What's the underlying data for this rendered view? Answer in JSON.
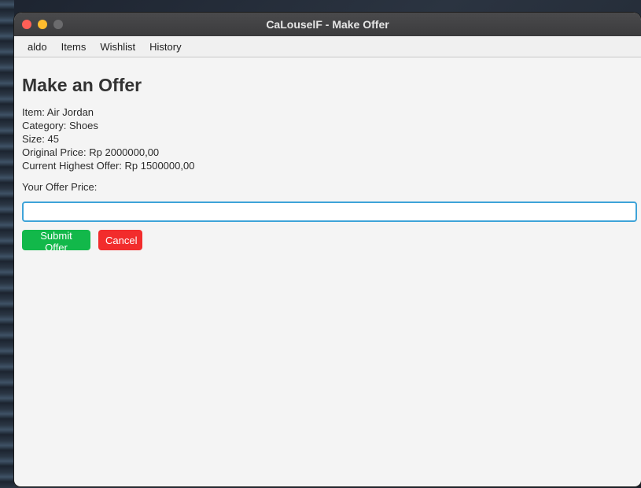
{
  "window": {
    "title": "CaLouselF - Make Offer"
  },
  "menu": {
    "items": [
      {
        "label": "aldo"
      },
      {
        "label": "Items"
      },
      {
        "label": "Wishlist"
      },
      {
        "label": "History"
      }
    ]
  },
  "page": {
    "heading": "Make an Offer",
    "details": {
      "item": "Item: Air Jordan",
      "category": "Category: Shoes",
      "size": "Size: 45",
      "original_price": "Original Price: Rp 2000000,00",
      "current_highest": "Current Highest Offer: Rp 1500000,00"
    },
    "offer_label": "Your Offer Price:",
    "offer_value": ""
  },
  "buttons": {
    "submit_label": "Submit Offer",
    "cancel_label": "Cancel"
  },
  "colors": {
    "submit": "#12b84a",
    "cancel": "#f22c2c",
    "focus_ring": "#3ea3d8"
  }
}
